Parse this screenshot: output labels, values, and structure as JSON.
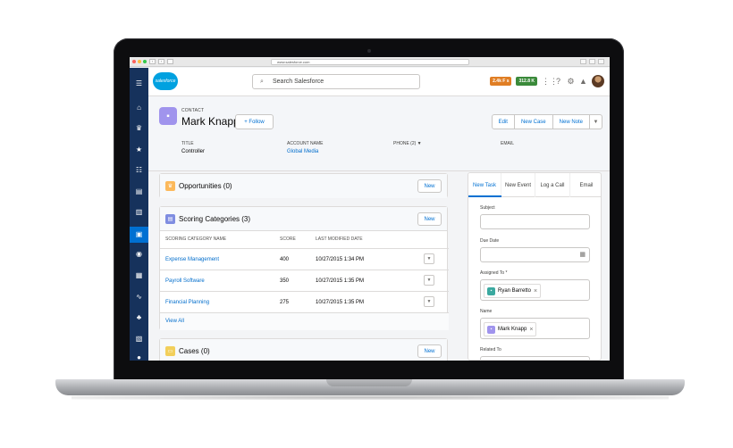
{
  "browser": {
    "url": "www.salesforce.com"
  },
  "header": {
    "logo_text": "salesforce",
    "search_placeholder": "Search Salesforce",
    "badge1": "2.4k F s",
    "badge2": "312.8 K",
    "badge1_color": "#e07e24",
    "badge2_color": "#3a8a3a"
  },
  "record": {
    "type": "CONTACT",
    "name": "Mark Knapp",
    "follow": "+ Follow",
    "actions": [
      "Edit",
      "New Case",
      "New Note"
    ],
    "fields": {
      "title_label": "TITLE",
      "title_value": "Controller",
      "account_label": "ACCOUNT NAME",
      "account_value": "Global Media",
      "phone_label": "PHONE (2)",
      "email_label": "EMAIL"
    }
  },
  "cards": {
    "opportunities": {
      "title": "Opportunities (0)",
      "new": "New"
    },
    "scoring": {
      "title": "Scoring Categories (3)",
      "new": "New",
      "headers": [
        "SCORING CATEGORY NAME",
        "SCORE",
        "LAST MODIFIED DATE"
      ],
      "rows": [
        {
          "name": "Expense Management",
          "score": "400",
          "date": "10/27/2015 1:34 PM"
        },
        {
          "name": "Payroll Software",
          "score": "350",
          "date": "10/27/2015 1:35 PM"
        },
        {
          "name": "Financial Planning",
          "score": "275",
          "date": "10/27/2015 1:35 PM"
        }
      ],
      "view_all": "View All"
    },
    "cases": {
      "title": "Cases (0)",
      "new": "New"
    }
  },
  "panel": {
    "tabs": [
      "New Task",
      "New Event",
      "Log a Call",
      "Email"
    ],
    "subject_label": "Subject",
    "due_label": "Due Date",
    "assigned_label": "Assigned To *",
    "assigned_value": "Ryan Barretto",
    "name_label": "Name",
    "name_value": "Mark Knapp",
    "related_label": "Related To"
  },
  "colors": {
    "nav": "#16325c",
    "accent": "#0070d2",
    "contact_icon": "#a094ed",
    "opps_icon": "#fcb95b",
    "cases_icon": "#f2cf5b"
  }
}
